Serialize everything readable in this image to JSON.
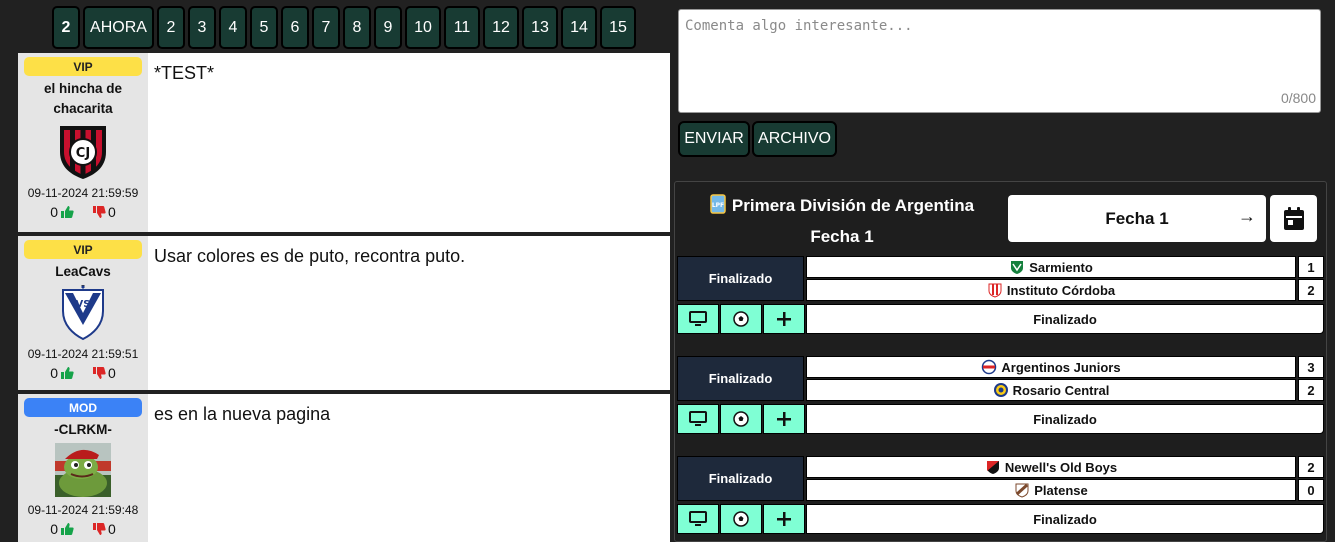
{
  "tabs": [
    {
      "label": "2",
      "active": true
    },
    {
      "label": "AHORA"
    },
    {
      "label": "2"
    },
    {
      "label": "3"
    },
    {
      "label": "4"
    },
    {
      "label": "5"
    },
    {
      "label": "6"
    },
    {
      "label": "7"
    },
    {
      "label": "8"
    },
    {
      "label": "9"
    },
    {
      "label": "10"
    },
    {
      "label": "11"
    },
    {
      "label": "12"
    },
    {
      "label": "13"
    },
    {
      "label": "14"
    },
    {
      "label": "15"
    }
  ],
  "comments": [
    {
      "badge": "VIP",
      "badge_type": "vip",
      "user": "el hincha de chacarita",
      "avatar": "chacarita-crest",
      "timestamp": "09-11-2024 21:59:59",
      "likes": "0",
      "dislikes": "0",
      "text": "*TEST*"
    },
    {
      "badge": "VIP",
      "badge_type": "vip",
      "user": "LeaCavs",
      "avatar": "velez-crest",
      "timestamp": "09-11-2024 21:59:51",
      "likes": "0",
      "dislikes": "0",
      "text": "Usar colores es de puto, recontra puto."
    },
    {
      "badge": "MOD",
      "badge_type": "mod",
      "user": "-CLRKM-",
      "avatar": "frog-avatar",
      "timestamp": "09-11-2024 21:59:48",
      "likes": "0",
      "dislikes": "0",
      "text": "es en la nueva pagina"
    }
  ],
  "composer": {
    "placeholder": "Comenta algo interesante...",
    "counter": "0/800",
    "send_label": "ENVIAR",
    "file_label": "ARCHIVO"
  },
  "fixture": {
    "league": "Primera División de Argentina",
    "round": "Fecha 1",
    "selector": "Fecha 1",
    "selector_arrow": "→",
    "matches": [
      {
        "status": "Finalizado",
        "home": "Sarmiento",
        "home_score": "1",
        "away": "Instituto Córdoba",
        "away_score": "2",
        "match_status": "Finalizado"
      },
      {
        "status": "Finalizado",
        "home": "Argentinos Juniors",
        "home_score": "3",
        "away": "Rosario Central",
        "away_score": "2",
        "match_status": "Finalizado"
      },
      {
        "status": "Finalizado",
        "home": "Newell's Old Boys",
        "home_score": "2",
        "away": "Platense",
        "away_score": "0",
        "match_status": "Finalizado"
      }
    ]
  },
  "colors": {
    "background": "#212121",
    "tab": "#183b33",
    "vip_badge": "#fde047",
    "mod_badge": "#3b82f6",
    "match_action": "#7fffd4",
    "status_cell": "#1e293b",
    "like": "#16a34a",
    "dislike": "#dc2626"
  }
}
